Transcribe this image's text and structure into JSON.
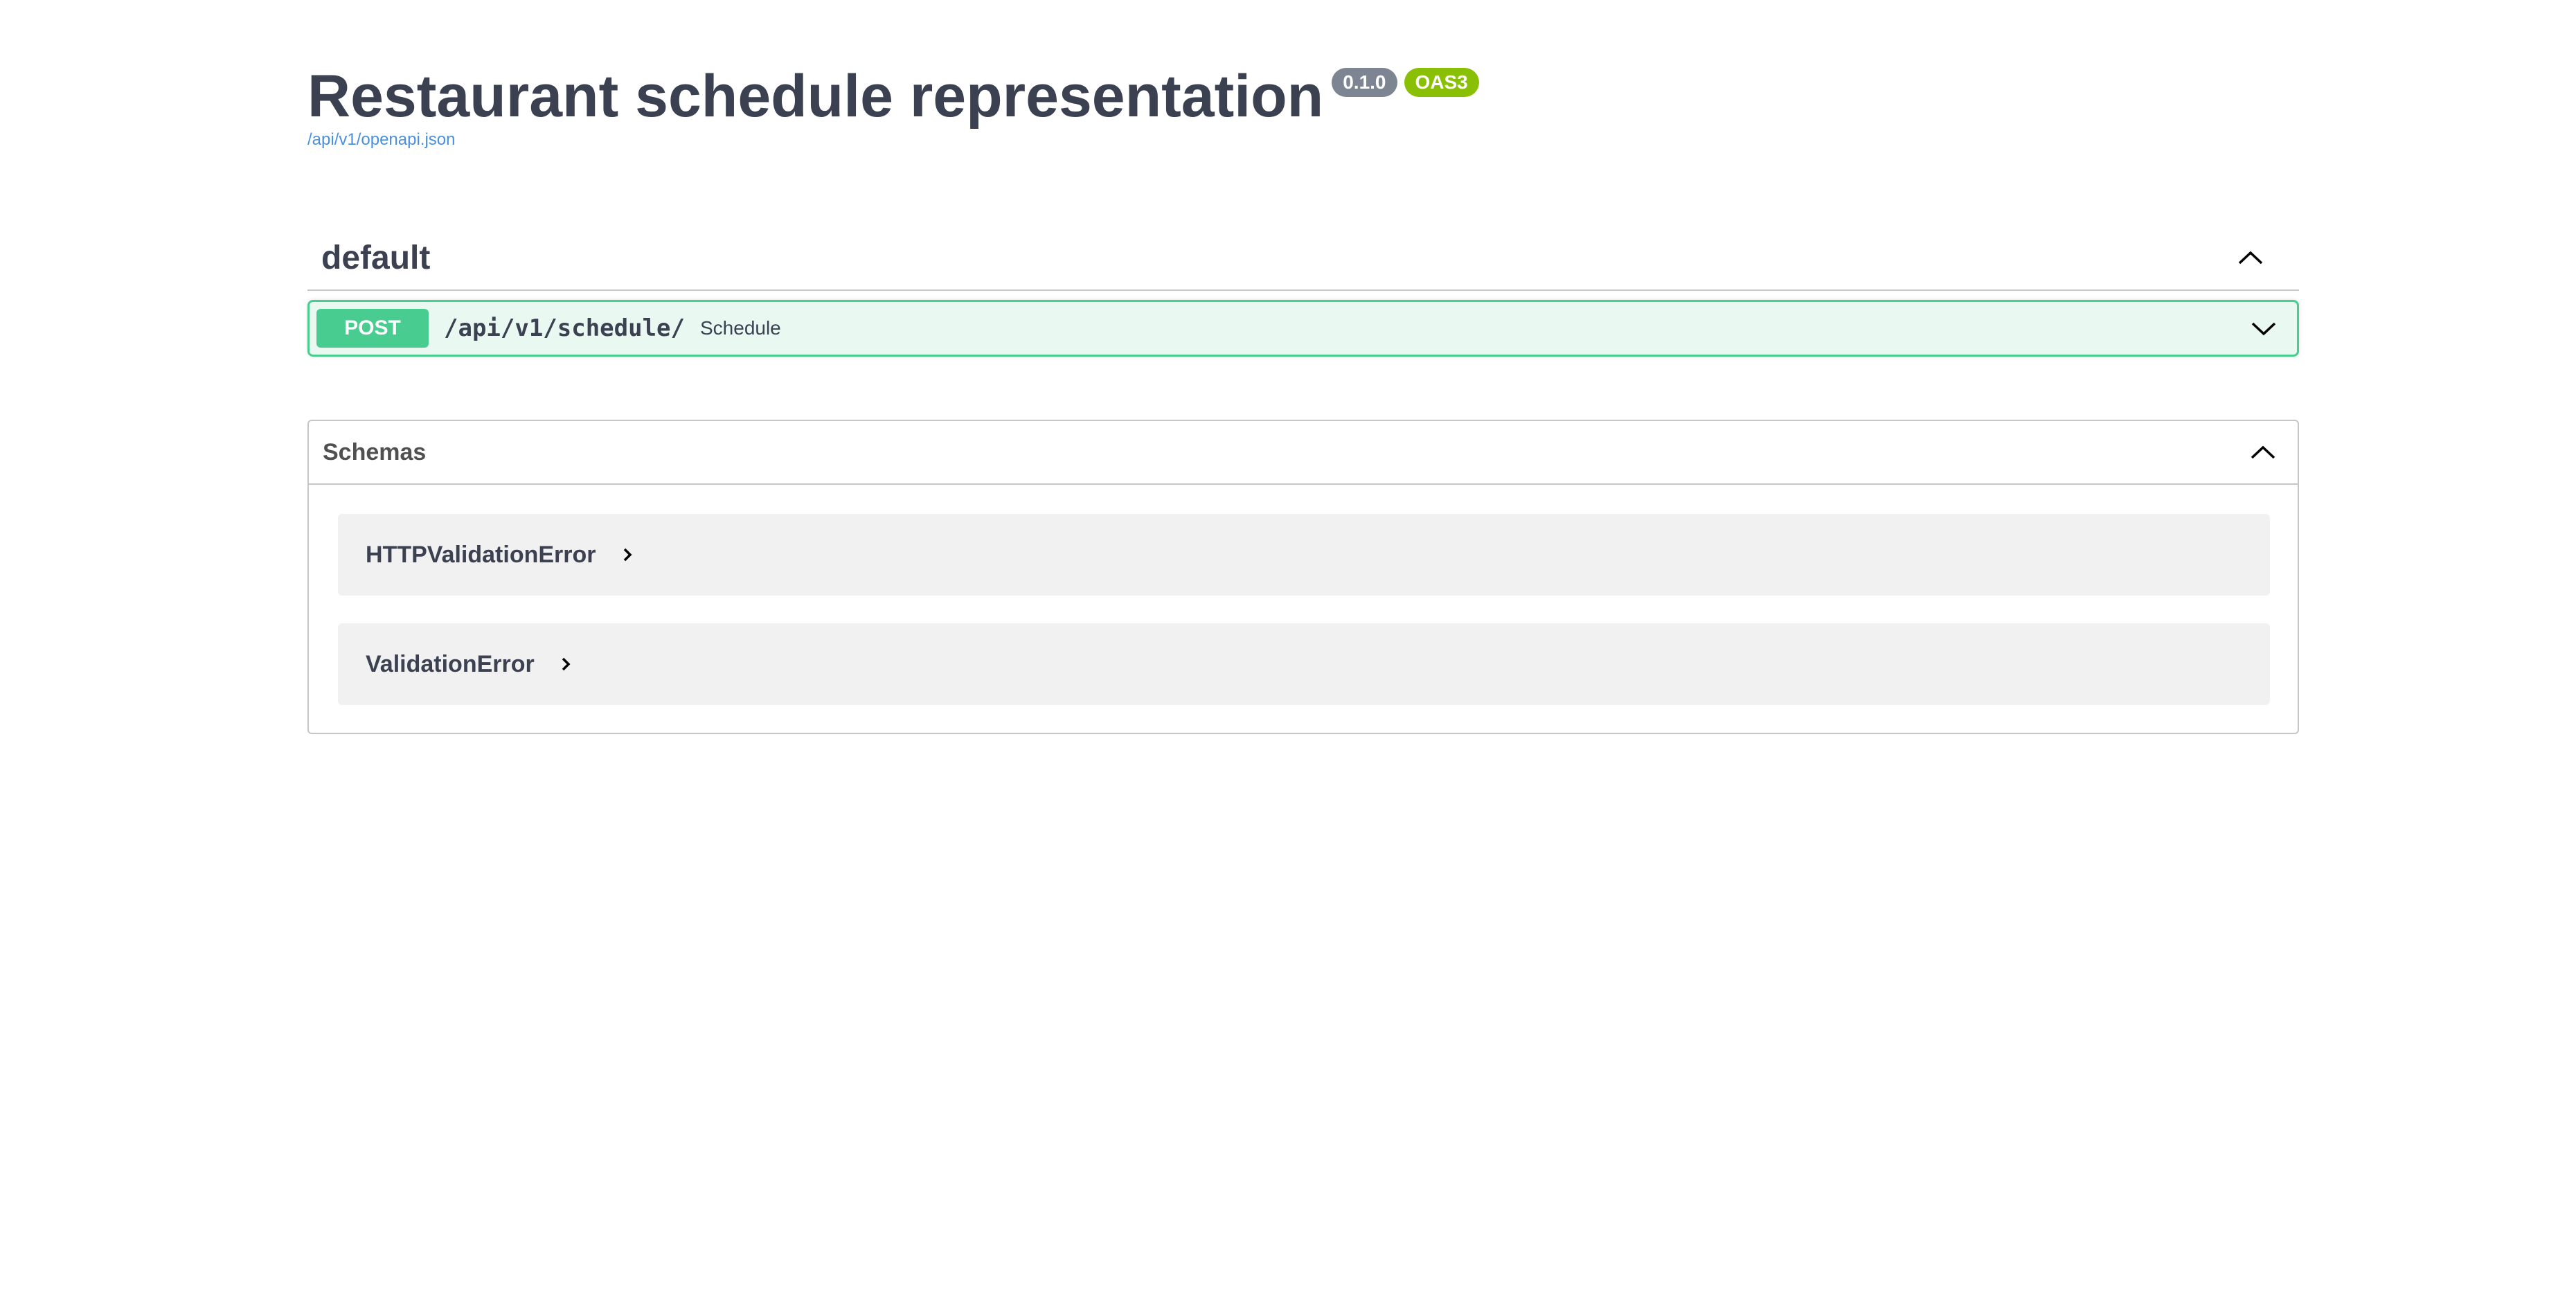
{
  "info": {
    "title": "Restaurant schedule representation",
    "version": "0.1.0",
    "oas_badge": "OAS3",
    "spec_url": "/api/v1/openapi.json"
  },
  "tag": {
    "name": "default",
    "toggle_icon": "chevron-up-icon"
  },
  "operation": {
    "method": "POST",
    "path": "/api/v1/schedule/",
    "summary": "Schedule",
    "toggle_icon": "chevron-down-icon"
  },
  "schemas": {
    "title": "Schemas",
    "toggle_icon": "chevron-up-icon",
    "models": [
      {
        "name": "HTTPValidationError",
        "icon": "chevron-right-icon"
      },
      {
        "name": "ValidationError",
        "icon": "chevron-right-icon"
      }
    ]
  },
  "colors": {
    "post_accent": "#49cc90",
    "version_badge": "#7d8492",
    "oas_badge": "#89bf04",
    "link": "#4990e2"
  }
}
